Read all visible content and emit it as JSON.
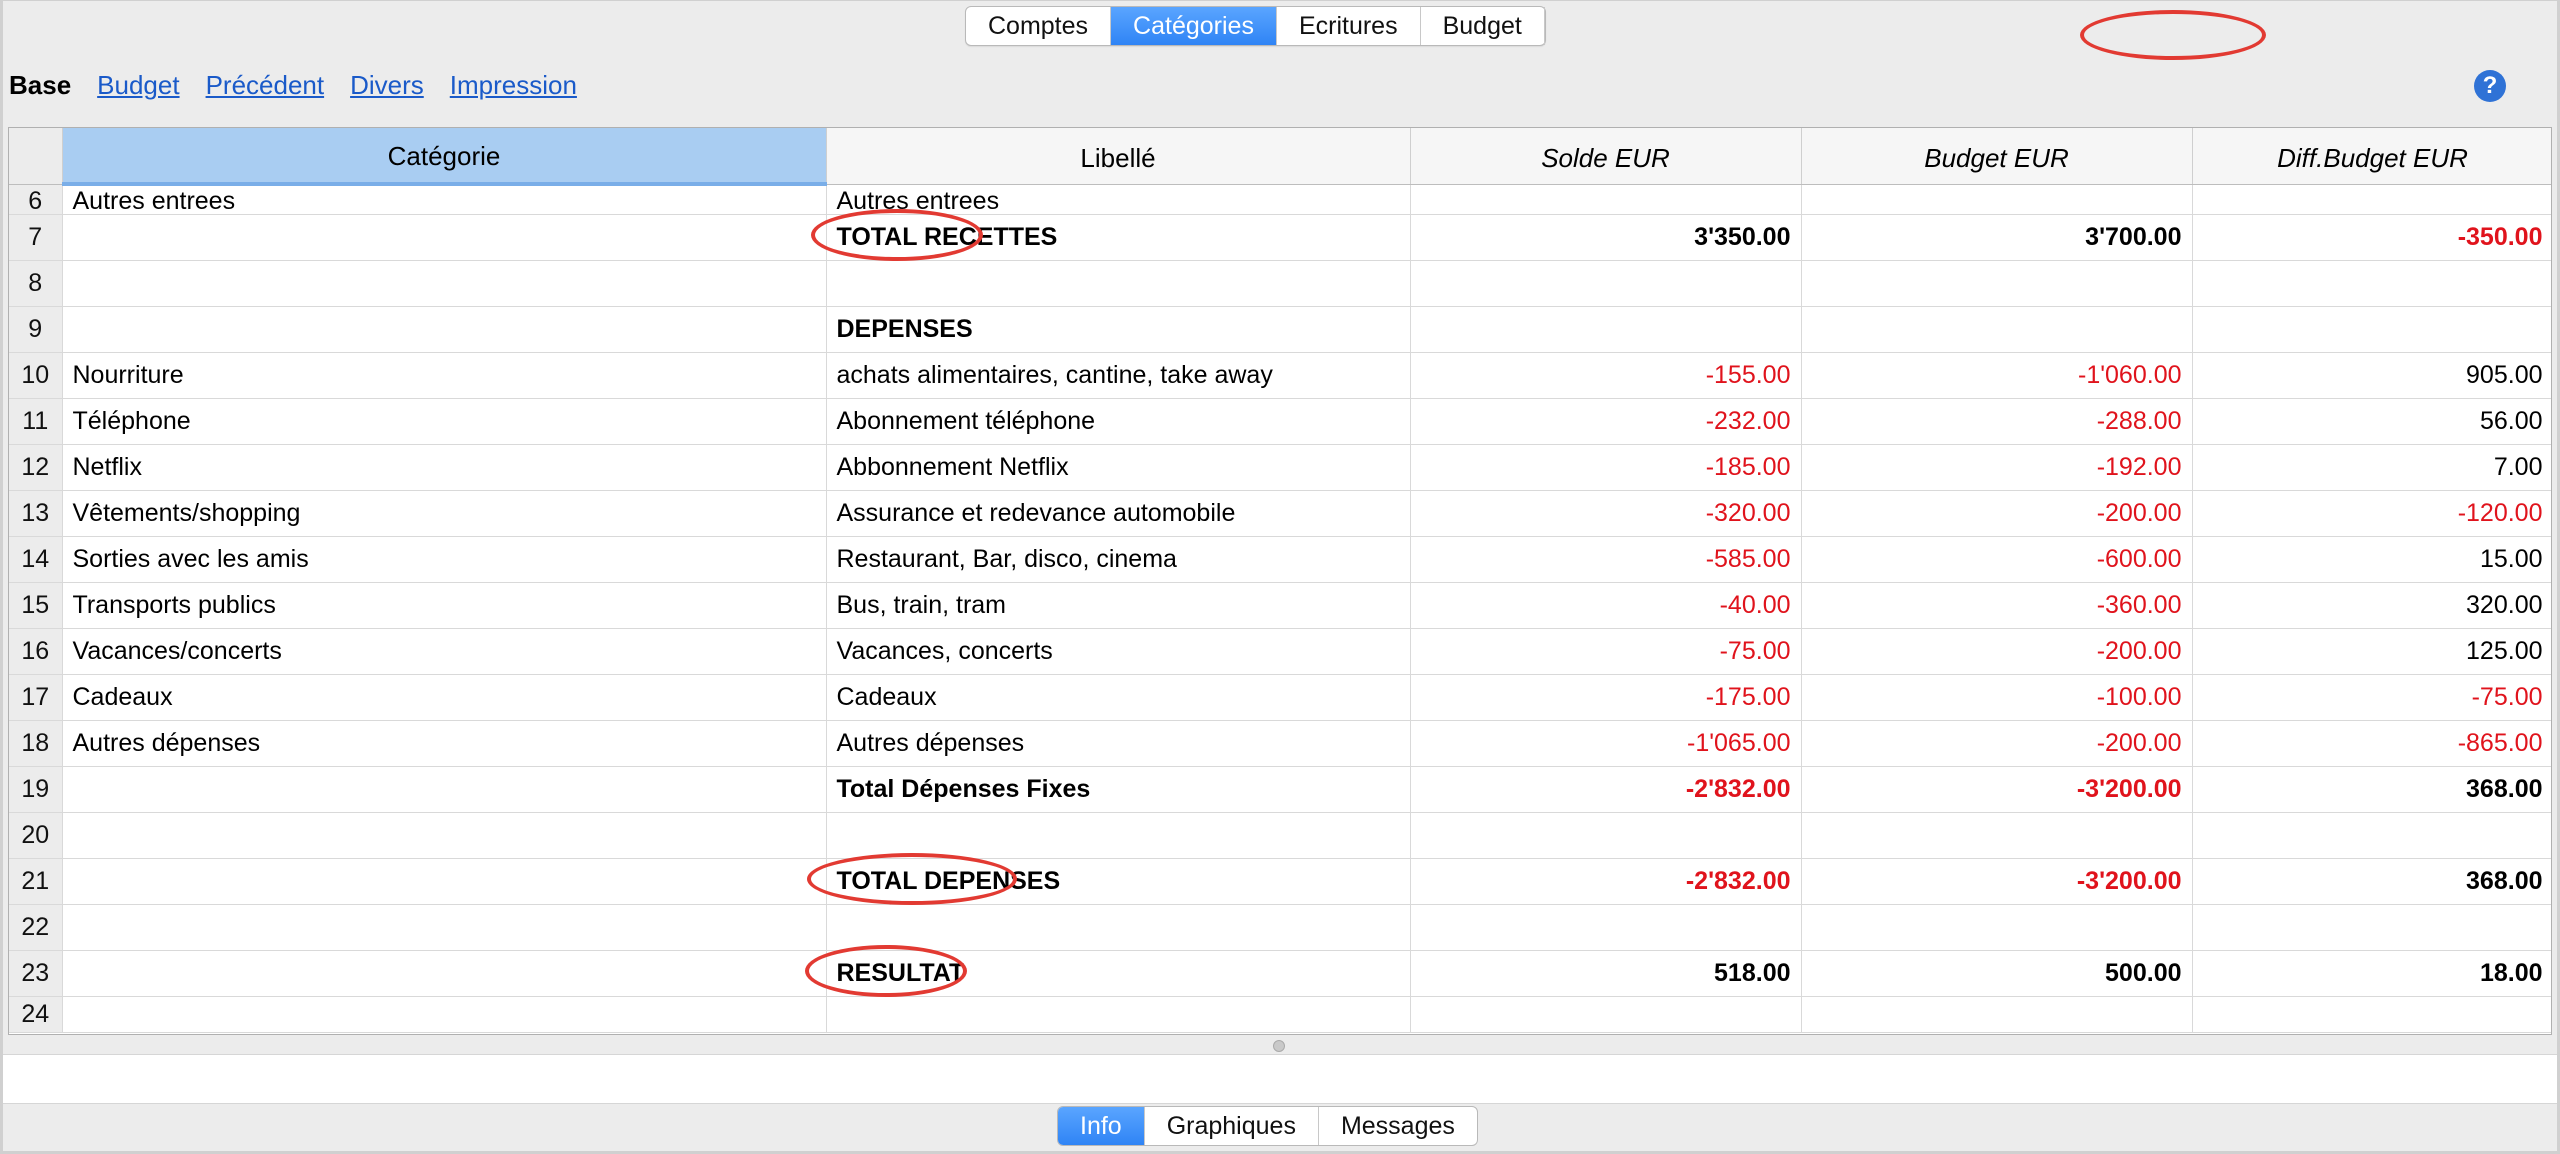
{
  "top_tabs": [
    "Comptes",
    "Catégories",
    "Ecritures",
    "Budget"
  ],
  "subnav": {
    "base": "Base",
    "links": [
      "Budget",
      "Précédent",
      "Divers",
      "Impression"
    ],
    "help": "?"
  },
  "table": {
    "headers": [
      "Catégorie",
      "Libellé",
      "Solde EUR",
      "Budget EUR",
      "Diff.Budget EUR"
    ],
    "rows": [
      {
        "n": "6",
        "cat": "Autres entrees",
        "lib": "Autres entrees",
        "solde": "",
        "budget": "",
        "diff": ""
      },
      {
        "n": "7",
        "cat": "",
        "lib": "TOTAL RECETTES",
        "solde": "3'350.00",
        "budget": "3'700.00",
        "diff": "-350.00"
      },
      {
        "n": "8",
        "cat": "",
        "lib": "",
        "solde": "",
        "budget": "",
        "diff": ""
      },
      {
        "n": "9",
        "cat": "",
        "lib": "DEPENSES",
        "solde": "",
        "budget": "",
        "diff": ""
      },
      {
        "n": "10",
        "cat": "Nourriture",
        "lib": "achats alimentaires, cantine, take away",
        "solde": "-155.00",
        "budget": "-1'060.00",
        "diff": "905.00"
      },
      {
        "n": "11",
        "cat": "Téléphone",
        "lib": "Abonnement téléphone",
        "solde": "-232.00",
        "budget": "-288.00",
        "diff": "56.00"
      },
      {
        "n": "12",
        "cat": "Netflix",
        "lib": "Abbonnement Netflix",
        "solde": "-185.00",
        "budget": "-192.00",
        "diff": "7.00"
      },
      {
        "n": "13",
        "cat": "Vêtements/shopping",
        "lib": "Assurance et redevance automobile",
        "solde": "-320.00",
        "budget": "-200.00",
        "diff": "-120.00"
      },
      {
        "n": "14",
        "cat": "Sorties avec les amis",
        "lib": "Restaurant, Bar, disco, cinema",
        "solde": "-585.00",
        "budget": "-600.00",
        "diff": "15.00"
      },
      {
        "n": "15",
        "cat": "Transports publics",
        "lib": "Bus, train, tram",
        "solde": "-40.00",
        "budget": "-360.00",
        "diff": "320.00"
      },
      {
        "n": "16",
        "cat": "Vacances/concerts",
        "lib": "Vacances, concerts",
        "solde": "-75.00",
        "budget": "-200.00",
        "diff": "125.00"
      },
      {
        "n": "17",
        "cat": "Cadeaux",
        "lib": "Cadeaux",
        "solde": "-175.00",
        "budget": "-100.00",
        "diff": "-75.00"
      },
      {
        "n": "18",
        "cat": "Autres dépenses",
        "lib": "Autres dépenses",
        "solde": "-1'065.00",
        "budget": "-200.00",
        "diff": "-865.00"
      },
      {
        "n": "19",
        "cat": "",
        "lib": "Total Dépenses Fixes",
        "solde": "-2'832.00",
        "budget": "-3'200.00",
        "diff": "368.00"
      },
      {
        "n": "20",
        "cat": "",
        "lib": "",
        "solde": "",
        "budget": "",
        "diff": ""
      },
      {
        "n": "21",
        "cat": "",
        "lib": "TOTAL DEPENSES",
        "solde": "-2'832.00",
        "budget": "-3'200.00",
        "diff": "368.00"
      },
      {
        "n": "22",
        "cat": "",
        "lib": "",
        "solde": "",
        "budget": "",
        "diff": ""
      },
      {
        "n": "23",
        "cat": "",
        "lib": "RESULTAT",
        "solde": "518.00",
        "budget": "500.00",
        "diff": "18.00"
      },
      {
        "n": "24",
        "cat": "",
        "lib": "",
        "solde": "",
        "budget": "",
        "diff": ""
      }
    ]
  },
  "bottom_tabs": [
    "Info",
    "Graphiques",
    "Messages"
  ],
  "colors": {
    "accent": "#2f84f5",
    "negative": "#e0131c",
    "annotation": "#e23a32",
    "selected_header": "#a9cdf2"
  }
}
